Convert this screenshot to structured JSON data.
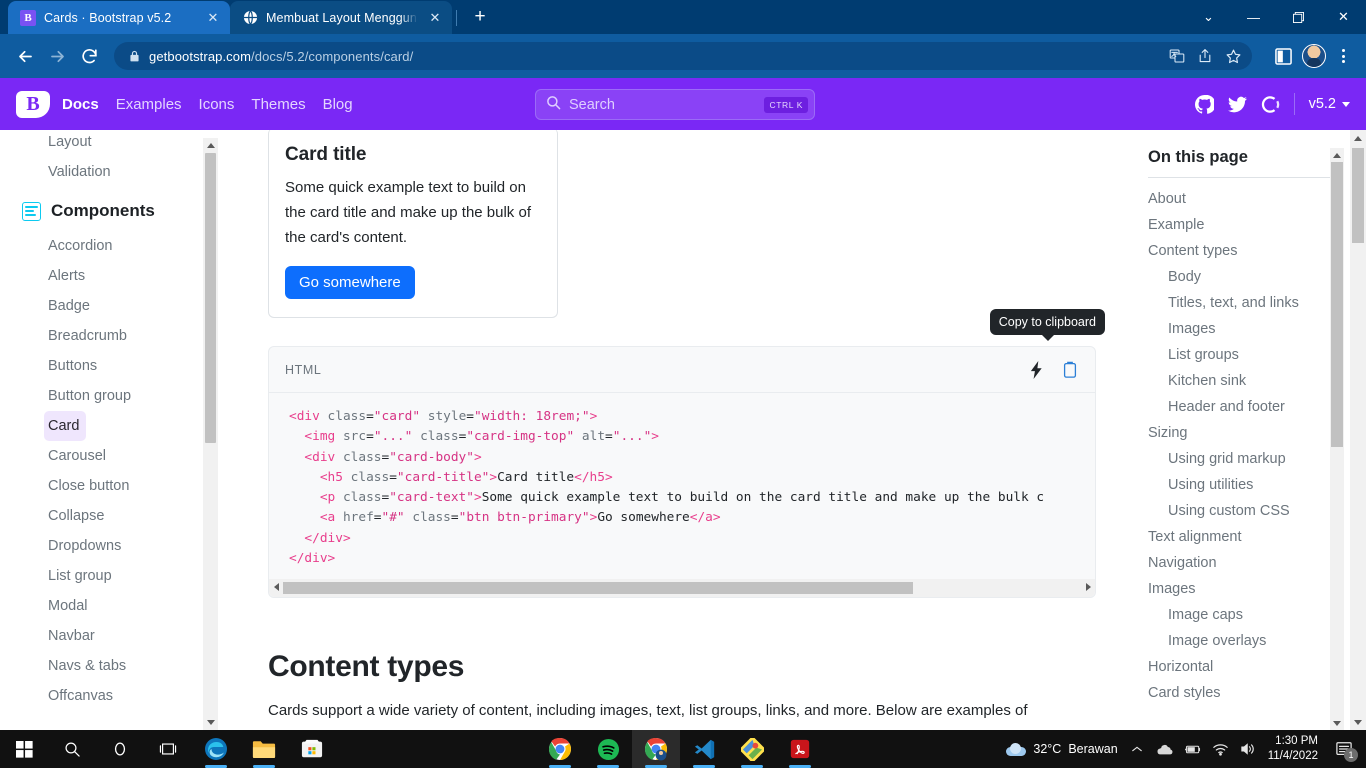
{
  "browser": {
    "tabs": [
      {
        "title": "Cards · Bootstrap v5.2",
        "favicon": "bootstrap-icon",
        "active": true
      },
      {
        "title": "Membuat Layout Menggunakan",
        "favicon": "globe-icon",
        "active": false
      }
    ],
    "new_tab_label": "+",
    "close_label": "✕",
    "window_controls": {
      "collapse": "⌄",
      "minimize": "—",
      "maximize": "❐",
      "close": "✕"
    },
    "address": {
      "domain": "getbootstrap.com",
      "path": "/docs/5.2/components/card/"
    },
    "nav": {
      "back": "←",
      "forward": "→",
      "reload": "⟳"
    },
    "omnibox_actions": [
      "translate-icon",
      "share-icon",
      "favorite-star-icon"
    ],
    "toolbar_right": [
      "split-screen-icon",
      "profile-avatar",
      "settings-menu-icon"
    ]
  },
  "bsnav": {
    "brand": "B",
    "links": [
      {
        "label": "Docs",
        "active": true
      },
      {
        "label": "Examples",
        "active": false
      },
      {
        "label": "Icons",
        "active": false
      },
      {
        "label": "Themes",
        "active": false
      },
      {
        "label": "Blog",
        "active": false
      }
    ],
    "search_placeholder": "Search",
    "search_shortcut": "CTRL K",
    "icons": [
      "github-icon",
      "twitter-icon",
      "opencollective-icon"
    ],
    "version": "v5.2",
    "accent_color": "#7a28f5"
  },
  "sidebar": {
    "top_items": [
      {
        "label": "Layout",
        "active": false
      },
      {
        "label": "Validation",
        "active": false
      }
    ],
    "group_title": "Components",
    "group_icon": "components-icon",
    "items": [
      {
        "label": "Accordion",
        "active": false
      },
      {
        "label": "Alerts",
        "active": false
      },
      {
        "label": "Badge",
        "active": false
      },
      {
        "label": "Breadcrumb",
        "active": false
      },
      {
        "label": "Buttons",
        "active": false
      },
      {
        "label": "Button group",
        "active": false
      },
      {
        "label": "Card",
        "active": true
      },
      {
        "label": "Carousel",
        "active": false
      },
      {
        "label": "Close button",
        "active": false
      },
      {
        "label": "Collapse",
        "active": false
      },
      {
        "label": "Dropdowns",
        "active": false
      },
      {
        "label": "List group",
        "active": false
      },
      {
        "label": "Modal",
        "active": false
      },
      {
        "label": "Navbar",
        "active": false
      },
      {
        "label": "Navs & tabs",
        "active": false
      },
      {
        "label": "Offcanvas",
        "active": false
      }
    ]
  },
  "main": {
    "demo_card": {
      "title": "Card title",
      "text": "Some quick example text to build on the card title and make up the bulk of the card's content.",
      "button_label": "Go somewhere",
      "button_color": "#0d6efd"
    },
    "code_block": {
      "language": "HTML",
      "lightning_icon": "lightning-bolt-icon",
      "copy_icon": "clipboard-copy-icon",
      "tooltip": "Copy to clipboard",
      "lines": [
        "<div class=\"card\" style=\"width: 18rem;\">",
        "  <img src=\"...\" class=\"card-img-top\" alt=\"...\">",
        "  <div class=\"card-body\">",
        "    <h5 class=\"card-title\">Card title</h5>",
        "    <p class=\"card-text\">Some quick example text to build on the card title and make up the bulk c",
        "    <a href=\"#\" class=\"btn btn-primary\">Go somewhere</a>",
        "  </div>",
        "</div>"
      ]
    },
    "section": {
      "heading": "Content types",
      "paragraph": "Cards support a wide variety of content, including images, text, list groups, links, and more. Below are examples of"
    }
  },
  "toc": {
    "title": "On this page",
    "items": [
      {
        "label": "About",
        "level": 1
      },
      {
        "label": "Example",
        "level": 1
      },
      {
        "label": "Content types",
        "level": 1
      },
      {
        "label": "Body",
        "level": 2
      },
      {
        "label": "Titles, text, and links",
        "level": 2
      },
      {
        "label": "Images",
        "level": 2
      },
      {
        "label": "List groups",
        "level": 2
      },
      {
        "label": "Kitchen sink",
        "level": 2
      },
      {
        "label": "Header and footer",
        "level": 2
      },
      {
        "label": "Sizing",
        "level": 1
      },
      {
        "label": "Using grid markup",
        "level": 2
      },
      {
        "label": "Using utilities",
        "level": 2
      },
      {
        "label": "Using custom CSS",
        "level": 2
      },
      {
        "label": "Text alignment",
        "level": 1
      },
      {
        "label": "Navigation",
        "level": 1
      },
      {
        "label": "Images",
        "level": 1
      },
      {
        "label": "Image caps",
        "level": 2
      },
      {
        "label": "Image overlays",
        "level": 2
      },
      {
        "label": "Horizontal",
        "level": 1
      },
      {
        "label": "Card styles",
        "level": 1
      }
    ]
  },
  "taskbar": {
    "left_icons": [
      "windows-start-icon",
      "search-icon",
      "cortana-icon",
      "task-view-icon"
    ],
    "pinned_icons": [
      "edge-icon",
      "file-explorer-icon",
      "microsoft-store-icon"
    ],
    "center_icons": [
      "chrome-icon",
      "spotify-icon",
      "chrome-profile-icon",
      "vscode-icon",
      "gimp-icon",
      "acrobat-reader-icon"
    ],
    "weather": {
      "temperature": "32°C",
      "condition": "Berawan",
      "icon": "cloud-icon"
    },
    "tray_icons": [
      "show-hidden-icons-chevron",
      "onedrive-icon",
      "battery-icon",
      "wifi-icon",
      "volume-icon"
    ],
    "clock": {
      "time": "1:30 PM",
      "date": "11/4/2022"
    },
    "notification": {
      "icon": "action-center-icon",
      "count": "1"
    }
  }
}
